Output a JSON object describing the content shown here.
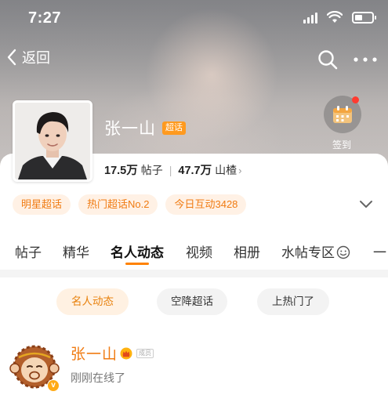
{
  "status_bar": {
    "time": "7:27"
  },
  "nav": {
    "back_label": "返回"
  },
  "profile": {
    "name": "张一山",
    "badge": "超话",
    "stats": [
      {
        "value": "17.5万",
        "label": "帖子"
      },
      {
        "value": "47.7万",
        "label": "山楂"
      }
    ],
    "checkin_label": "签到"
  },
  "tags": [
    "明星超话",
    "热门超话No.2",
    "今日互动3428"
  ],
  "tabs": [
    "帖子",
    "精华",
    "名人动态",
    "视频",
    "相册",
    "水帖专区",
    "一"
  ],
  "active_tab": "名人动态",
  "filters": [
    "名人动态",
    "空降超话",
    "上热门了"
  ],
  "post": {
    "author": "张一山",
    "member_tag": "成员",
    "status": "刚刚在线了"
  },
  "colors": {
    "accent": "#ff8200",
    "tag_text": "#f07b12",
    "tag_bg": "#fff1e5",
    "notification_dot": "#ff3b30"
  }
}
